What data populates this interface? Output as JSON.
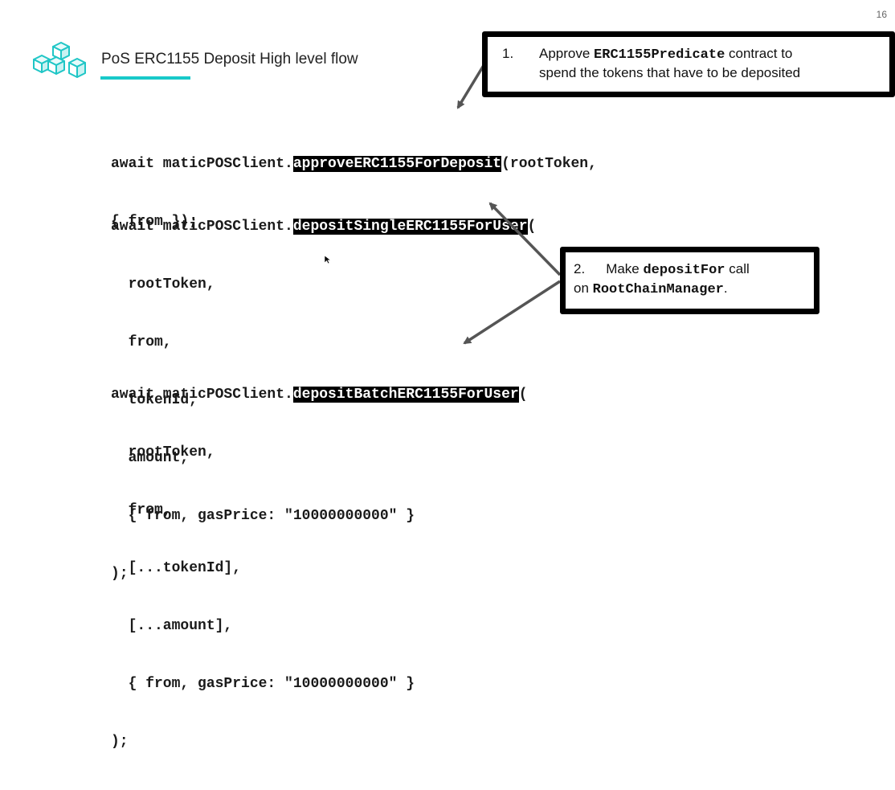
{
  "slide": {
    "page_number": "16",
    "title": "PoS ERC1155 Deposit High level flow",
    "logo_icon": "cubes-logo-icon",
    "accent_color": "#18c9c9"
  },
  "code": {
    "block1": {
      "line1_pre": "await maticPOSClient.",
      "line1_hl": "approveERC1155ForDeposit",
      "line1_post": "(rootToken,",
      "line2": "{ from });"
    },
    "block2": {
      "line1_pre": "await maticPOSClient.",
      "line1_hl": "depositSingleERC1155ForUser",
      "line1_post": "(",
      "line2": "  rootToken,",
      "line3": "  from,",
      "line4": "  tokenId,",
      "line5": "  amount,",
      "line6": "  { from, gasPrice: \"10000000000\" }",
      "line7": ");"
    },
    "block3": {
      "line1_pre": "await maticPOSClient.",
      "line1_hl": "depositBatchERC1155ForUser",
      "line1_post": "(",
      "line2": "  rootToken,",
      "line3": "  from,",
      "line4": "  [...tokenId],",
      "line5": "  [...amount],",
      "line6": "  { from, gasPrice: \"10000000000\" }",
      "line7": ");"
    }
  },
  "callouts": {
    "step1": {
      "number": "1.",
      "text_before": "Approve ",
      "mono": "ERC1155Predicate",
      "text_after": " contract to",
      "line2": "spend the tokens that have to be deposited"
    },
    "step2": {
      "number": "2.",
      "text_before": "Make ",
      "mono": "depositFor",
      "text_after": " call",
      "line2_before": "on ",
      "line2_mono": "RootChainManager",
      "line2_after": "."
    }
  }
}
